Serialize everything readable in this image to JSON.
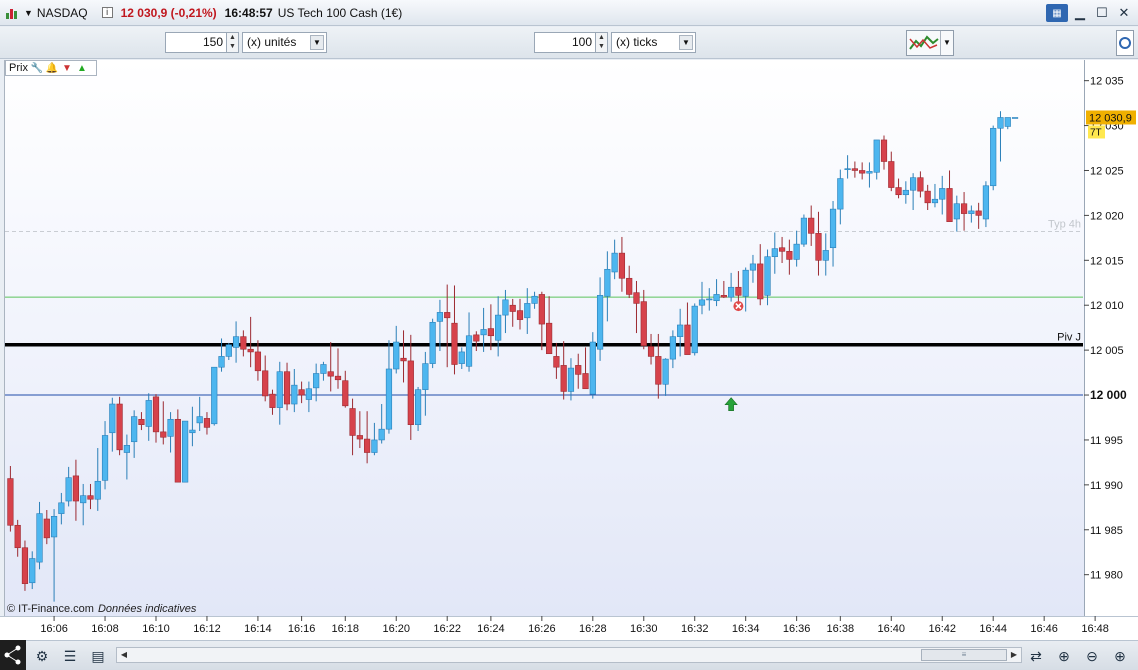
{
  "window": {
    "symbol": "NASDAQ",
    "info_icon": "i",
    "price_change": "12 030,9 (-0,21%)",
    "time": "16:48:57",
    "instrument": "US Tech 100 Cash (1€)"
  },
  "toolbar": {
    "units_value": "150",
    "units_label": "(x) unités",
    "ticks_value": "100",
    "ticks_label": "(x) ticks"
  },
  "legend": {
    "label": "Prix"
  },
  "copyright": {
    "source": "© IT-Finance.com",
    "note": "Données indicatives"
  },
  "icons": [
    "wrench-icon",
    "bell-icon",
    "sell-order-icon",
    "buy-order-icon",
    "minimize-icon",
    "maximize-icon",
    "close-icon",
    "keyboard-icon",
    "share-icon",
    "tools-icon",
    "layers-icon",
    "zoom-out-icon",
    "zoom-in-icon"
  ],
  "colors": {
    "up": "#4db6ef",
    "down": "#d6424b",
    "accent_price": "#f0b000",
    "pivot": "#000000",
    "support_green": "#5cc45c",
    "blue_level": "#1f4aa8"
  },
  "chart_data": {
    "type": "candlestick",
    "title": "",
    "y_ticks": [
      11980,
      11985,
      11990,
      11995,
      12000,
      12005,
      12010,
      12015,
      12020,
      12025,
      12030,
      12035
    ],
    "y_tick_labels": [
      "11 980",
      "11 985",
      "11 990",
      "11 995",
      "12 000",
      "12 005",
      "12 010",
      "12 015",
      "12 020",
      "12 025",
      "12 030",
      "12 035"
    ],
    "ylim": [
      11975.4,
      12037.3
    ],
    "x_tick_labels": [
      "16:06",
      "16:08",
      "16:10",
      "16:12",
      "16:14",
      "16:16",
      "16:18",
      "16:20",
      "16:22",
      "16:24",
      "16:26",
      "16:28",
      "16:30",
      "16:32",
      "16:34",
      "16:36",
      "16:38",
      "16:40",
      "16:42",
      "16:44",
      "16:46",
      "16:48"
    ],
    "x_tick_index": [
      6,
      13,
      20,
      27,
      34,
      40,
      46,
      53,
      60,
      66,
      73,
      80,
      87,
      94,
      101,
      108,
      114,
      121,
      128,
      135,
      142,
      149
    ],
    "grid": false,
    "current_price": "12 030,9",
    "current_price_value": 12030.9,
    "ticks_remaining": "7T",
    "levels": [
      {
        "name": "Piv J",
        "value": 12005.6,
        "style": "thick-black"
      },
      {
        "name": "",
        "value": 12010.9,
        "style": "green"
      },
      {
        "name": "",
        "value": 12000.0,
        "style": "blue"
      },
      {
        "name": "Typ 4h",
        "value": 12018.2,
        "style": "dashed-grey"
      }
    ],
    "markers": [
      {
        "type": "sell-cross",
        "index": 100,
        "value": 12009.9
      },
      {
        "type": "buy-arrow",
        "index": 99,
        "value": 12001.6
      }
    ],
    "candles": [
      [
        11990.7,
        11992.1,
        11984.8,
        11985.5
      ],
      [
        11985.5,
        11986.1,
        11982.0,
        11983.0
      ],
      [
        11983.0,
        11983.8,
        11978.2,
        11979.0
      ],
      [
        11979.1,
        11982.6,
        11978.4,
        11981.8
      ],
      [
        11981.4,
        11988.1,
        11980.6,
        11986.8
      ],
      [
        11986.2,
        11987.2,
        11983.4,
        11984.1
      ],
      [
        11984.2,
        11987.3,
        11977.0,
        11986.5
      ],
      [
        11986.8,
        11989.1,
        11985.6,
        11988.0
      ],
      [
        11988.2,
        11992.0,
        11987.6,
        11990.8
      ],
      [
        11991.0,
        11992.8,
        11986.0,
        11988.2
      ],
      [
        11988.0,
        11990.1,
        11985.5,
        11988.8
      ],
      [
        11988.8,
        11990.1,
        11987.3,
        11988.4
      ],
      [
        11988.4,
        11994.1,
        11987.1,
        11990.4
      ],
      [
        11990.5,
        11997.1,
        11989.5,
        11995.5
      ],
      [
        11995.8,
        11999.7,
        11993.7,
        11999.0
      ],
      [
        11999.0,
        11999.8,
        11993.3,
        11993.9
      ],
      [
        11993.6,
        11995.6,
        11990.6,
        11994.4
      ],
      [
        11994.8,
        11998.3,
        11993.0,
        11997.6
      ],
      [
        11997.3,
        11998.1,
        11996.1,
        11996.7
      ],
      [
        11996.5,
        12000.2,
        11994.9,
        11999.4
      ],
      [
        11999.8,
        12000.1,
        11994.7,
        11995.9
      ],
      [
        11995.9,
        11999.3,
        11994.5,
        11995.3
      ],
      [
        11995.4,
        11998.1,
        11993.6,
        11997.3
      ],
      [
        11997.3,
        11998.4,
        11990.3,
        11990.3
      ],
      [
        11990.3,
        11997.1,
        11990.3,
        11997.1
      ],
      [
        11995.8,
        11998.7,
        11994.3,
        11996.1
      ],
      [
        11996.9,
        11999.8,
        11996.0,
        11997.6
      ],
      [
        11997.4,
        11998.1,
        11995.6,
        11996.4
      ],
      [
        11996.8,
        12003.1,
        11996.6,
        12003.1
      ],
      [
        12003.1,
        12006.3,
        12002.6,
        12004.3
      ],
      [
        12004.3,
        12005.8,
        12003.9,
        12005.6
      ],
      [
        12005.3,
        12008.2,
        12003.6,
        12006.5
      ],
      [
        12006.5,
        12007.2,
        12004.3,
        12005.1
      ],
      [
        12005.1,
        12008.7,
        12003.1,
        12004.8
      ],
      [
        12004.8,
        12006.1,
        12001.6,
        12002.7
      ],
      [
        12002.7,
        12004.4,
        11999.3,
        11999.9
      ],
      [
        12000.1,
        12000.6,
        11997.8,
        11998.6
      ],
      [
        11998.6,
        12003.7,
        11996.7,
        12002.6
      ],
      [
        12002.6,
        12003.6,
        11998.3,
        11999.0
      ],
      [
        11999.0,
        12002.9,
        11998.1,
        12001.1
      ],
      [
        12000.6,
        12001.5,
        11999.1,
        12000.0
      ],
      [
        11999.5,
        12001.5,
        11998.1,
        12000.7
      ],
      [
        12000.8,
        12003.5,
        11999.3,
        12002.4
      ],
      [
        12002.4,
        12003.7,
        12001.6,
        12003.4
      ],
      [
        12002.6,
        12005.9,
        12000.4,
        12002.1
      ],
      [
        12002.1,
        12005.2,
        12000.7,
        12001.7
      ],
      [
        12001.6,
        12002.7,
        11998.6,
        11998.8
      ],
      [
        11998.5,
        11999.6,
        11993.3,
        11995.5
      ],
      [
        11995.5,
        11998.2,
        11994.1,
        11995.1
      ],
      [
        11995.1,
        11998.2,
        11992.4,
        11993.6
      ],
      [
        11993.6,
        11996.9,
        11993.3,
        11995.0
      ],
      [
        11995.0,
        11999.0,
        11994.6,
        11996.2
      ],
      [
        11996.2,
        12006.1,
        11995.7,
        12002.9
      ],
      [
        12002.9,
        12007.7,
        12002.4,
        12005.9
      ],
      [
        12004.1,
        12007.2,
        12001.4,
        12003.8
      ],
      [
        12003.8,
        12006.7,
        11995.0,
        11996.7
      ],
      [
        11996.7,
        12000.9,
        11996.0,
        12000.6
      ],
      [
        12000.6,
        12004.8,
        11997.7,
        12003.5
      ],
      [
        12003.5,
        12008.5,
        12003.0,
        12008.1
      ],
      [
        12008.2,
        12010.6,
        12004.9,
        12009.2
      ],
      [
        12009.2,
        12012.3,
        12003.1,
        12008.6
      ],
      [
        12008.0,
        12012.2,
        12002.3,
        12003.4
      ],
      [
        12003.5,
        12005.3,
        12002.9,
        12004.8
      ],
      [
        12003.2,
        12009.2,
        12002.6,
        12006.6
      ],
      [
        12006.7,
        12007.1,
        12004.9,
        12006.0
      ],
      [
        12006.7,
        12009.7,
        12004.8,
        12007.3
      ],
      [
        12007.4,
        12010.1,
        12005.0,
        12006.6
      ],
      [
        12006.1,
        12011.0,
        12004.3,
        12008.9
      ],
      [
        12008.9,
        12011.7,
        12006.9,
        12010.6
      ],
      [
        12010.0,
        12010.7,
        12007.6,
        12009.3
      ],
      [
        12009.4,
        12010.7,
        12007.3,
        12008.4
      ],
      [
        12008.6,
        12011.9,
        12006.8,
        12010.2
      ],
      [
        12010.2,
        12011.5,
        12009.6,
        12011.0
      ],
      [
        12011.2,
        12011.5,
        12005.0,
        12007.9
      ],
      [
        12008.0,
        12011.0,
        12004.7,
        12004.6
      ],
      [
        12004.3,
        12005.8,
        12001.8,
        12003.1
      ],
      [
        12003.3,
        12006.0,
        11999.5,
        12000.4
      ],
      [
        12000.4,
        12004.1,
        11999.4,
        12003.0
      ],
      [
        12003.3,
        12004.6,
        12000.7,
        12002.3
      ],
      [
        12002.4,
        12005.3,
        12001.2,
        12000.7
      ],
      [
        12000.1,
        12007.0,
        11999.6,
        12005.9
      ],
      [
        12005.1,
        12013.1,
        12003.8,
        12011.1
      ],
      [
        12011.0,
        12016.0,
        12008.2,
        12014.0
      ],
      [
        12013.7,
        12017.3,
        12012.9,
        12015.8
      ],
      [
        12015.8,
        12017.6,
        12011.5,
        12013.0
      ],
      [
        12013.0,
        12014.4,
        12010.8,
        12011.2
      ],
      [
        12011.4,
        12012.7,
        12006.9,
        12010.2
      ],
      [
        12010.4,
        12011.7,
        12005.1,
        12005.5
      ],
      [
        12005.4,
        12006.8,
        12003.4,
        12004.3
      ],
      [
        12004.3,
        12006.8,
        11999.6,
        12001.2
      ],
      [
        12001.2,
        12004.1,
        11999.9,
        12004.0
      ],
      [
        12004.0,
        12007.2,
        12003.0,
        12006.5
      ],
      [
        12006.5,
        12009.6,
        12004.3,
        12007.8
      ],
      [
        12007.8,
        12010.3,
        12004.7,
        12004.5
      ],
      [
        12004.7,
        12010.2,
        12004.4,
        12009.9
      ],
      [
        12010.0,
        12012.6,
        12009.0,
        12010.6
      ],
      [
        12010.7,
        12011.9,
        12009.4,
        12010.7
      ],
      [
        12010.5,
        12012.9,
        12009.9,
        12011.2
      ],
      [
        12011.1,
        12012.7,
        12010.8,
        12010.9
      ],
      [
        12010.9,
        12013.6,
        12010.4,
        12012.0
      ],
      [
        12012.0,
        12013.8,
        12009.5,
        12011.1
      ],
      [
        12011.0,
        12014.2,
        12009.3,
        12013.9
      ],
      [
        12013.9,
        12015.6,
        12012.5,
        12014.6
      ],
      [
        12014.6,
        12016.8,
        12010.0,
        12010.7
      ],
      [
        12011.1,
        12016.2,
        12010.0,
        12015.4
      ],
      [
        12015.4,
        12018.1,
        12013.5,
        12016.3
      ],
      [
        12016.4,
        12017.6,
        12014.7,
        12016.0
      ],
      [
        12016.0,
        12017.3,
        12013.4,
        12015.1
      ],
      [
        12015.1,
        12018.3,
        12014.3,
        12016.8
      ],
      [
        12016.8,
        12020.1,
        12016.5,
        12019.7
      ],
      [
        12019.7,
        12021.1,
        12016.6,
        12018.0
      ],
      [
        12018.0,
        12020.4,
        12013.3,
        12015.0
      ],
      [
        12015.0,
        12018.0,
        12013.3,
        12016.1
      ],
      [
        12016.4,
        12021.6,
        12014.3,
        12020.7
      ],
      [
        12020.7,
        12025.1,
        12019.0,
        12024.1
      ],
      [
        12025.1,
        12026.7,
        12024.1,
        12025.2
      ],
      [
        12025.2,
        12026.0,
        12024.2,
        12025.0
      ],
      [
        12025.0,
        12025.9,
        12024.0,
        12024.7
      ],
      [
        12024.7,
        12025.9,
        12023.1,
        12024.9
      ],
      [
        12024.8,
        12028.4,
        12024.0,
        12028.4
      ],
      [
        12028.4,
        12028.9,
        12025.1,
        12026.0
      ],
      [
        12026.0,
        12027.1,
        12022.7,
        12023.1
      ],
      [
        12023.1,
        12024.1,
        12021.9,
        12022.3
      ],
      [
        12022.3,
        12023.8,
        12021.3,
        12022.8
      ],
      [
        12022.8,
        12024.7,
        12020.6,
        12024.2
      ],
      [
        12024.2,
        12024.9,
        12022.0,
        12022.7
      ],
      [
        12022.7,
        12023.4,
        12020.6,
        12021.4
      ],
      [
        12021.4,
        12023.5,
        12020.9,
        12021.8
      ],
      [
        12021.8,
        12024.4,
        12020.1,
        12023.0
      ],
      [
        12023.0,
        12025.0,
        12020.4,
        12019.3
      ],
      [
        12019.6,
        12022.2,
        12018.2,
        12021.3
      ],
      [
        12021.3,
        12022.6,
        12018.3,
        12020.2
      ],
      [
        12020.2,
        12021.1,
        12019.2,
        12020.5
      ],
      [
        12020.5,
        12021.4,
        12018.5,
        12020.0
      ],
      [
        12019.6,
        12023.8,
        12018.7,
        12023.3
      ],
      [
        12023.3,
        12030.0,
        12022.8,
        12029.7
      ],
      [
        12029.7,
        12031.6,
        12026.0,
        12030.9
      ],
      [
        12029.9,
        12030.9,
        12029.6,
        12030.9
      ],
      [
        12030.9,
        12030.9,
        12030.9,
        12030.9
      ]
    ]
  }
}
